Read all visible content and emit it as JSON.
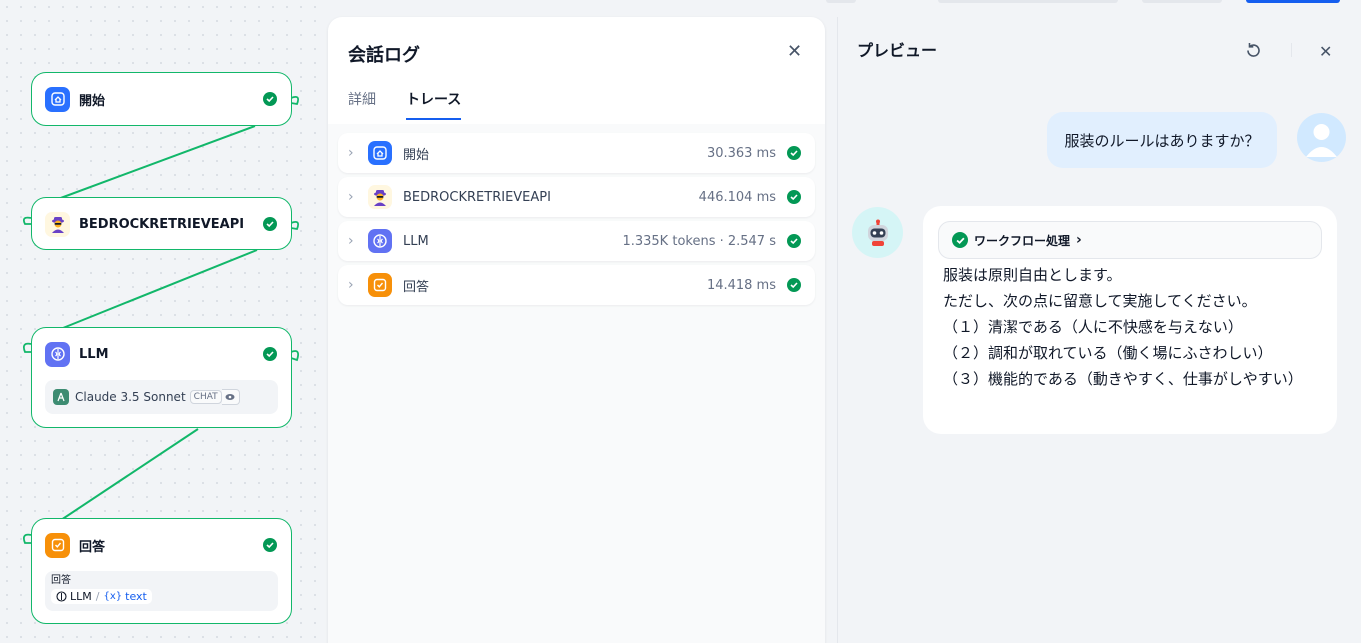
{
  "canvas": {
    "nodes": [
      {
        "id": "start",
        "title": "開始",
        "status": "success"
      },
      {
        "id": "bedrock",
        "title": "BEDROCKRETRIEVEAPI",
        "status": "success"
      },
      {
        "id": "llm",
        "title": "LLM",
        "status": "success",
        "model": "Claude 3.5 Sonnet",
        "model_badge": "CHAT"
      },
      {
        "id": "answer",
        "title": "回答",
        "status": "success",
        "field_label": "回答",
        "var_source": "LLM",
        "var_separator": "/",
        "var_name": "text",
        "var_prefix": "{x}"
      }
    ]
  },
  "log_panel": {
    "title": "会話ログ",
    "close_icon": "close-icon",
    "tabs": [
      {
        "label": "詳細",
        "active": false
      },
      {
        "label": "トレース",
        "active": true
      }
    ],
    "trace": [
      {
        "name": "開始",
        "meta": "30.363 ms",
        "icon": "home-icon",
        "color": "#2970ff"
      },
      {
        "name": "BEDROCKRETRIEVEAPI",
        "meta": "446.104 ms",
        "icon": "spy-icon",
        "color": "#fff7e0"
      },
      {
        "name": "LLM",
        "meta": "1.335K tokens · 2.547 s",
        "icon": "brain-icon",
        "color": "#6172f3"
      },
      {
        "name": "回答",
        "meta": "14.418 ms",
        "icon": "answer-icon",
        "color": "#f79009"
      }
    ]
  },
  "preview": {
    "title": "プレビュー",
    "user_message": "服装のルールはありますか？",
    "workflow_label": "ワークフロー処理",
    "answer_lines": [
      "服装は原則自由とします。",
      "ただし、次の点に留意して実施してください。",
      "（１）清潔である（人に不快感を与えない）",
      "（２）調和が取れている（働く場にふさわしい）",
      "（３）機能的である（動きやすく、仕事がしやすい）"
    ]
  },
  "colors": {
    "edge": "#12b76a",
    "success": "#039855",
    "accent": "#155eef"
  }
}
